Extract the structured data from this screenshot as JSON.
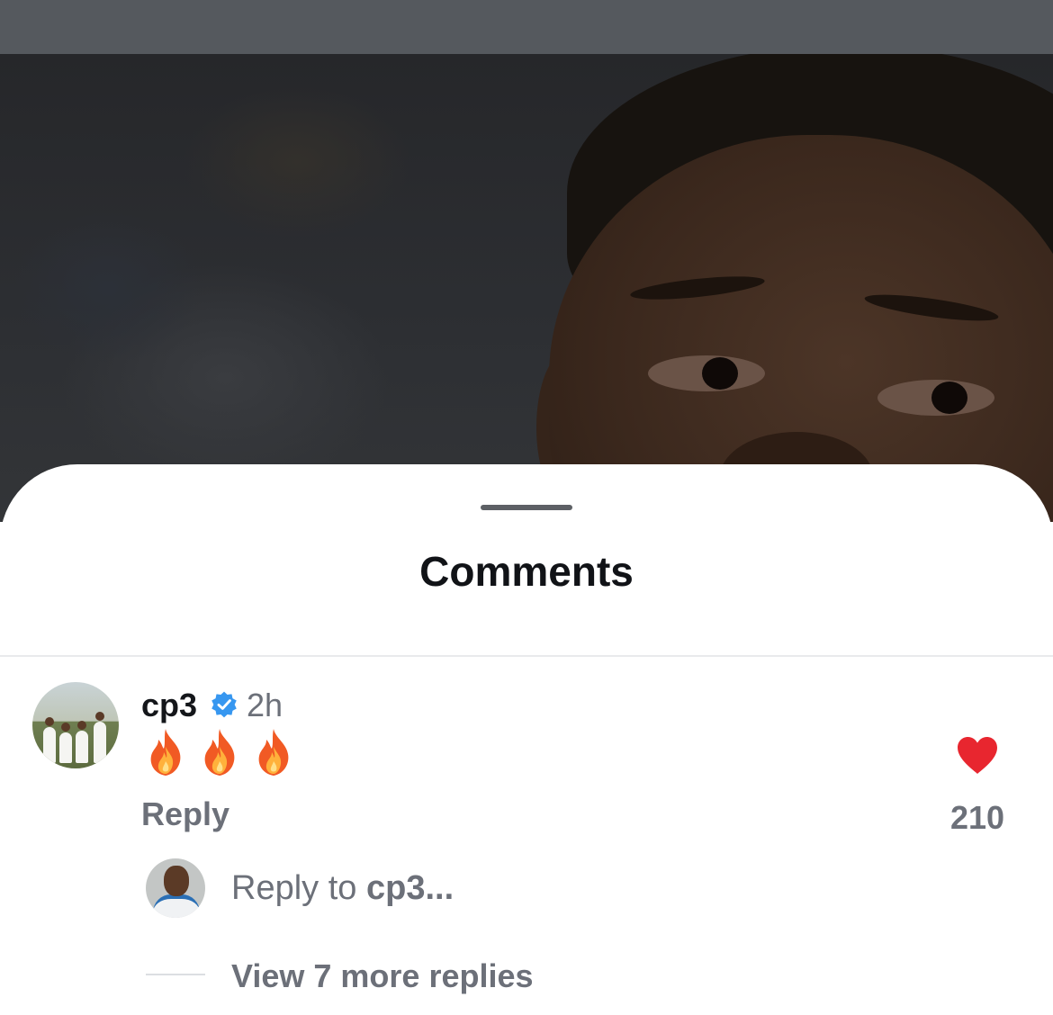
{
  "sheet": {
    "title": "Comments"
  },
  "comment": {
    "username": "cp3",
    "verified": true,
    "time": "2h",
    "text": "🔥🔥🔥",
    "reply_label": "Reply",
    "like_count": "210",
    "liked": true,
    "heart_color": "#e8262f"
  },
  "reply_box": {
    "prefix": "Reply to ",
    "target": "cp3...",
    "replier": "cp3"
  },
  "replies": {
    "view_more_label": "View 7 more replies"
  },
  "colors": {
    "verified_badge": "#3797f0",
    "secondary_text": "#6c7079"
  },
  "icons": [
    "verified-badge-icon",
    "fire-emoji-icon",
    "heart-icon",
    "drag-handle-icon"
  ]
}
